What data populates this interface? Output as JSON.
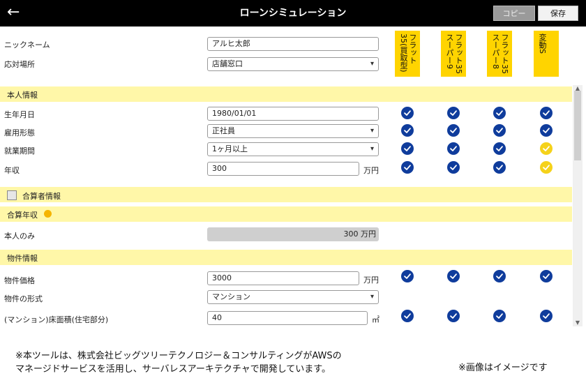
{
  "header": {
    "title": "ローンシミュレーション",
    "copy_label": "コピー",
    "save_label": "保存"
  },
  "plans": [
    {
      "label": "フラット35(買取型)"
    },
    {
      "label": "フラット35スーパー9"
    },
    {
      "label": "フラット35スーパー8"
    },
    {
      "label": "変動S"
    }
  ],
  "fields": {
    "nickname": {
      "label": "ニックネーム",
      "value": "アルヒ太郎"
    },
    "store": {
      "label": "応対場所",
      "value": "店舗窓口"
    },
    "dob": {
      "label": "生年月日",
      "value": "1980/01/01"
    },
    "employment": {
      "label": "雇用形態",
      "value": "正社員"
    },
    "tenure": {
      "label": "就業期間",
      "value": "1ヶ月以上"
    },
    "income": {
      "label": "年収",
      "value": "300",
      "unit": "万円"
    },
    "self_only": {
      "label": "本人のみ",
      "value": "300 万円"
    },
    "price": {
      "label": "物件価格",
      "value": "3000",
      "unit": "万円"
    },
    "form": {
      "label": "物件の形式",
      "value": "マンション"
    },
    "floor": {
      "label": "(マンション)床面積(住宅部分)",
      "value": "40",
      "unit": "㎡"
    }
  },
  "sections": {
    "personal": "本人情報",
    "co_applicant": "合算者情報",
    "combined_income": "合算年収",
    "property": "物件情報"
  },
  "status_colors": {
    "ok": "#0f3c9c",
    "warn": "#f5d21a",
    "accent": "#ffd400",
    "section": "#fff7a8"
  },
  "checks": {
    "dob": [
      "ok",
      "ok",
      "ok",
      "ok"
    ],
    "employment": [
      "ok",
      "ok",
      "ok",
      "ok"
    ],
    "tenure": [
      "ok",
      "ok",
      "ok",
      "warn"
    ],
    "income": [
      "ok",
      "ok",
      "ok",
      "warn"
    ],
    "price": [
      "ok",
      "ok",
      "ok",
      "ok"
    ],
    "floor": [
      "ok",
      "ok",
      "ok",
      "ok"
    ]
  },
  "notes": {
    "line1": "※本ツールは、株式会社ビッグツリーテクノロジー＆コンサルティングがAWSの",
    "line2": "マネージドサービスを活用し、サーバレスアーキテクチャで開発しています。",
    "image_note": "※画像はイメージです"
  }
}
